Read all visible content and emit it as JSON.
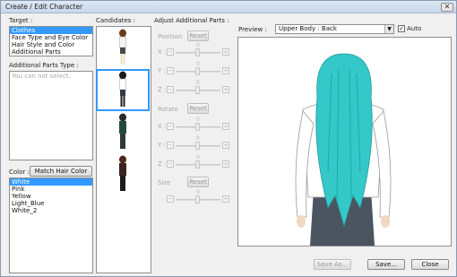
{
  "window": {
    "title": "Create / Edit Character",
    "close_label": "✕"
  },
  "target": {
    "label": "Target :",
    "items": [
      "Clothes",
      "Face Type and Eye Color",
      "Hair Style and Color",
      "Additional Parts"
    ],
    "selected_index": 0
  },
  "additional_parts_type": {
    "label": "Additional Parts Type :",
    "placeholder": "You can not select."
  },
  "color": {
    "label": "Color :",
    "match_button": "Match Hair Color",
    "items": [
      "White",
      "Pink",
      "Yellow",
      "Light_Blue",
      "White_2"
    ],
    "selected_index": 0
  },
  "candidates": {
    "label": "Candidates :",
    "selected_index": 1
  },
  "adjust": {
    "label": "Adjust Additional Parts :",
    "position": {
      "label": "Position",
      "reset": "Reset"
    },
    "rotate": {
      "label": "Rotate",
      "reset": "Reset"
    },
    "size": {
      "label": "Size",
      "reset": "Reset"
    },
    "axis_x": "X :",
    "axis_y": "Y :",
    "axis_z": "Z :",
    "zero": "0",
    "minus": "−",
    "plus": "+"
  },
  "preview": {
    "label": "Preview :",
    "view_select": "Upper Body : Back",
    "auto_label": "Auto",
    "auto_checked": true
  },
  "footer": {
    "save_as": "Save As...",
    "save": "Save...",
    "close": "Close"
  },
  "colors": {
    "accent": "#3399ff",
    "hair": "#35c8c8",
    "shirt": "#ffffff",
    "skirt": "#4a5560"
  }
}
